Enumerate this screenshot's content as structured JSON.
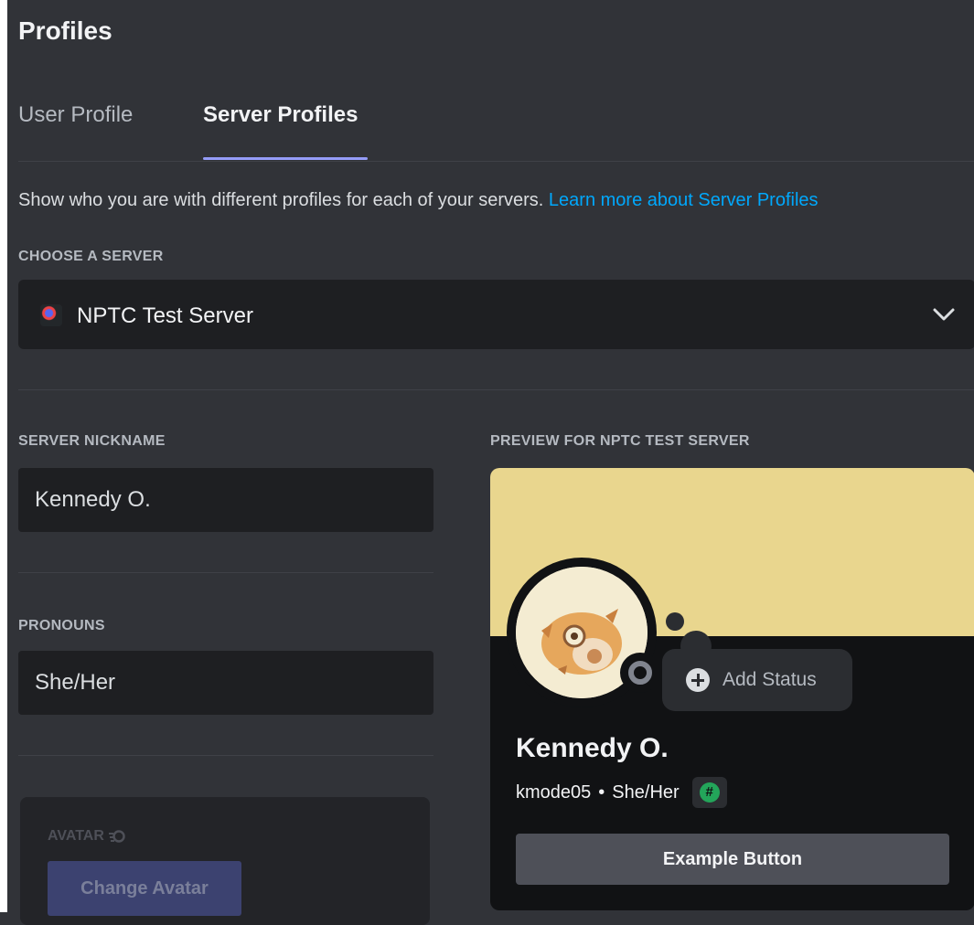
{
  "page": {
    "title": "Profiles"
  },
  "tabs": [
    {
      "label": "User Profile",
      "active": false
    },
    {
      "label": "Server Profiles",
      "active": true
    }
  ],
  "description": {
    "text": "Show who you are with different profiles for each of your servers.",
    "link": "Learn more about Server Profiles"
  },
  "server_select": {
    "label": "CHOOSE A SERVER",
    "value": "NPTC Test Server",
    "icon": "server-avatar-icon"
  },
  "nickname": {
    "label": "SERVER NICKNAME",
    "value": "Kennedy O."
  },
  "pronouns": {
    "label": "PRONOUNS",
    "value": "She/Her"
  },
  "avatar": {
    "label": "AVATAR",
    "button": "Change Avatar",
    "icon": "nitro-icon"
  },
  "preview": {
    "label": "PREVIEW FOR NPTC TEST SERVER",
    "display_name": "Kennedy O.",
    "username": "kmode05",
    "separator": "•",
    "pronouns": "She/Her",
    "badge": "#",
    "add_status": "Add Status",
    "example_button": "Example Button",
    "banner_color": "#e9d68e"
  },
  "colors": {
    "accent": "#949cf7",
    "link": "#00a8fc",
    "background": "#313338"
  }
}
